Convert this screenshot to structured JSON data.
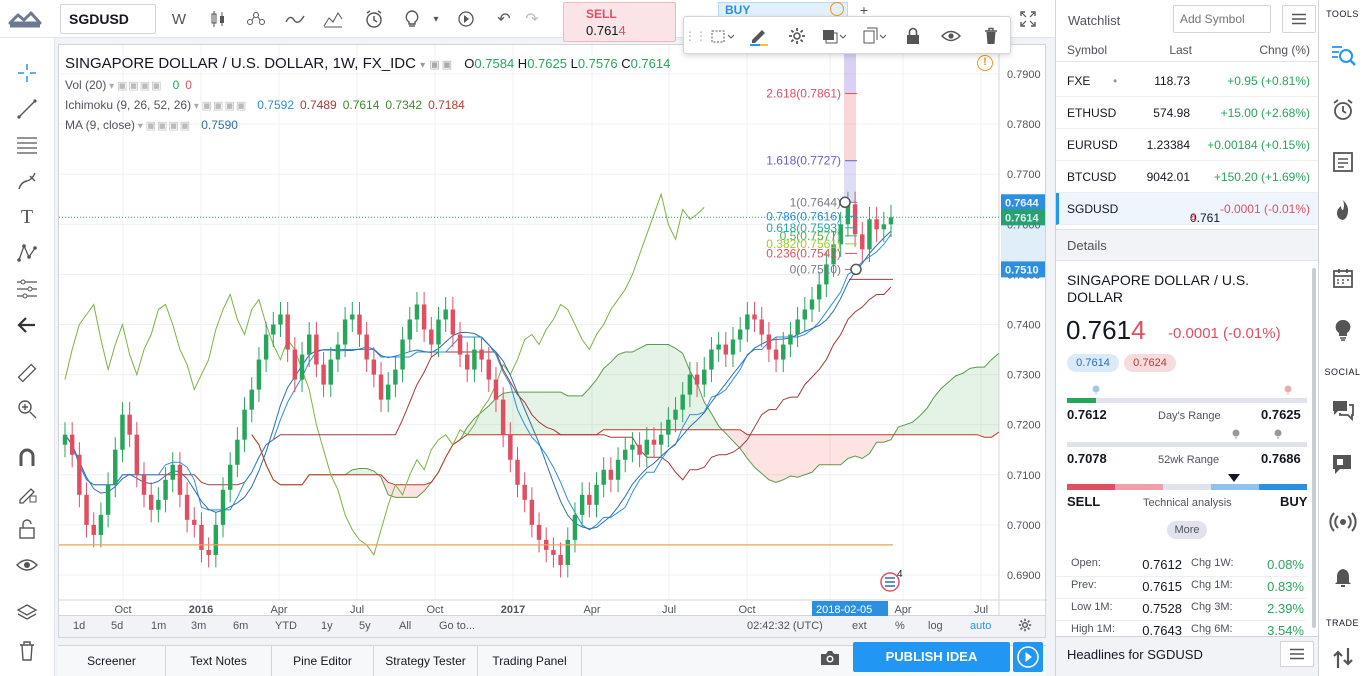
{
  "toolbar": {
    "symbol": "SGDUSD",
    "interval": "W",
    "sell_label": "SELL",
    "sell_price_main": "0.761",
    "sell_price_last": "4",
    "buy_label": "BUY"
  },
  "chart": {
    "title": "SINGAPORE DOLLAR / U.S. DOLLAR, 1W, FX_IDC",
    "ohlc": {
      "o_label": "O",
      "o": "0.7584",
      "h_label": "H",
      "h": "0.7625",
      "l_label": "L",
      "l": "0.7576",
      "c_label": "C",
      "c": "0.7614"
    },
    "indicators": [
      {
        "name": "Vol (20)",
        "values": [
          {
            "v": "0",
            "color": "#26a65b"
          },
          {
            "v": "0",
            "color": "#e04e62"
          }
        ]
      },
      {
        "name": "Ichimoku (9, 26, 52, 26)",
        "values": [
          {
            "v": "0.7592",
            "color": "#2d8fe0"
          },
          {
            "v": "0.7489",
            "color": "#a33a3a"
          },
          {
            "v": "0.7614",
            "color": "#3b8a2c"
          },
          {
            "v": "0.7342",
            "color": "#3b8a2c"
          },
          {
            "v": "0.7184",
            "color": "#c0392b"
          }
        ]
      },
      {
        "name": "MA (9, close)",
        "values": [
          {
            "v": "0.7590",
            "color": "#2d6fb0"
          }
        ]
      }
    ],
    "fib_levels": [
      {
        "label": "2.618(0.7861)",
        "color": "#e04e62"
      },
      {
        "label": "1.618(0.7727)",
        "color": "#6a5bd6"
      },
      {
        "label": "1(0.7644)",
        "color": "#787b86"
      },
      {
        "label": "0.786(0.7616)",
        "color": "#2d8fe0"
      },
      {
        "label": "0.618(0.7593)",
        "color": "#26a69a"
      },
      {
        "label": "0.5(0.7577)",
        "color": "#4caf50"
      },
      {
        "label": "0.382(0.7561)",
        "color": "#9acd32"
      },
      {
        "label": "0.236(0.7542)",
        "color": "#e04e62"
      },
      {
        "label": "0(0.7510)",
        "color": "#787b86"
      }
    ],
    "price_ticks": [
      "0.7900",
      "0.7800",
      "0.7700",
      "0.7600",
      "0.7500",
      "0.7400",
      "0.7300",
      "0.7200",
      "0.7100",
      "0.7000",
      "0.6900"
    ],
    "price_tags": [
      {
        "v": "0.7644",
        "bg": "#2d8fe0"
      },
      {
        "v": "0.7614",
        "bg": "#26a65b"
      },
      {
        "v": "0.7510",
        "bg": "#2d8fe0"
      }
    ],
    "time_ticks": [
      "Oct",
      "2016",
      "Apr",
      "Jul",
      "Oct",
      "2017",
      "Apr",
      "Jul",
      "Oct",
      "2018-02-05",
      "Apr",
      "Jul"
    ],
    "event_badge": "4"
  },
  "chart_data": {
    "type": "candlestick",
    "title": "SINGAPORE DOLLAR / U.S. DOLLAR, 1W, FX_IDC",
    "x_start": "2015-07",
    "x_end": "2018-07",
    "ylim": [
      0.685,
      0.795
    ],
    "close": [
      0.718,
      0.714,
      0.706,
      0.7,
      0.698,
      0.702,
      0.708,
      0.715,
      0.722,
      0.718,
      0.71,
      0.706,
      0.703,
      0.705,
      0.709,
      0.712,
      0.706,
      0.701,
      0.7,
      0.695,
      0.694,
      0.7,
      0.707,
      0.712,
      0.717,
      0.723,
      0.727,
      0.733,
      0.738,
      0.74,
      0.742,
      0.735,
      0.729,
      0.734,
      0.738,
      0.732,
      0.728,
      0.733,
      0.736,
      0.741,
      0.742,
      0.738,
      0.733,
      0.73,
      0.725,
      0.728,
      0.731,
      0.737,
      0.741,
      0.744,
      0.739,
      0.736,
      0.741,
      0.743,
      0.738,
      0.734,
      0.731,
      0.735,
      0.733,
      0.729,
      0.725,
      0.718,
      0.713,
      0.708,
      0.705,
      0.7,
      0.697,
      0.695,
      0.694,
      0.692,
      0.697,
      0.702,
      0.706,
      0.704,
      0.708,
      0.711,
      0.709,
      0.713,
      0.715,
      0.716,
      0.714,
      0.717,
      0.716,
      0.718,
      0.721,
      0.723,
      0.726,
      0.73,
      0.728,
      0.731,
      0.735,
      0.736,
      0.734,
      0.737,
      0.739,
      0.742,
      0.741,
      0.738,
      0.735,
      0.733,
      0.736,
      0.738,
      0.741,
      0.743,
      0.745,
      0.748,
      0.752,
      0.756,
      0.76,
      0.764,
      0.758,
      0.755,
      0.761,
      0.759,
      0.76,
      0.7614
    ],
    "series": [
      {
        "name": "MA (9, close)",
        "color": "#2d6fb0"
      },
      {
        "name": "Ichimoku (9, 26, 52, 26)",
        "color": "#2d8fe0"
      }
    ]
  },
  "range_bar": {
    "ranges": [
      "1d",
      "5d",
      "1m",
      "3m",
      "6m",
      "YTD",
      "1y",
      "5y",
      "All"
    ],
    "goto": "Go to...",
    "clock": "02:42:32 (UTC)",
    "ext": "ext",
    "pct": "%",
    "log": "log",
    "auto": "auto"
  },
  "bottom_tabs": [
    "Screener",
    "Text Notes",
    "Pine Editor",
    "Strategy Tester",
    "Trading Panel"
  ],
  "publish_label": "PUBLISH IDEA",
  "watchlist": {
    "title": "Watchlist",
    "add_placeholder": "Add Symbol",
    "col_symbol": "Symbol",
    "col_last": "Last",
    "col_chng": "Chng (%)",
    "rows": [
      {
        "symbol": "FXE",
        "dot": "•",
        "last": "118.73",
        "chng": "+0.95 (+0.81%)",
        "dir": "pos"
      },
      {
        "symbol": "ETHUSD",
        "dot": "",
        "last": "574.98",
        "chng": "+15.00 (+2.68%)",
        "dir": "pos"
      },
      {
        "symbol": "EURUSD",
        "dot": "",
        "last": "1.23384",
        "chng": "+0.00184 (+0.15%)",
        "dir": "pos"
      },
      {
        "symbol": "BTCUSD",
        "dot": "",
        "last": "9042.01",
        "chng": "+150.20 (+1.69%)",
        "dir": "pos"
      },
      {
        "symbol": "SGDUSD",
        "dot": "",
        "last_main": "0.761",
        "last_tail": "4",
        "chng": "-0.0001 (-0.01%)",
        "dir": "neg"
      }
    ]
  },
  "details": {
    "title": "Details",
    "name": "SINGAPORE DOLLAR / U.S. DOLLAR",
    "price_main": "0.761",
    "price_tail": "4",
    "change": "-0.0001 (-0.01%)",
    "bid": "0.7614",
    "ask": "0.7624",
    "day_low": "0.7612",
    "day_high": "0.7625",
    "day_label": "Day's Range",
    "day_pos": 0.12,
    "wk52_low": "0.7078",
    "wk52_high": "0.7686",
    "wk52_label": "52wk Range",
    "wk52_pos": 0.88,
    "ta_sell": "SELL",
    "ta_label": "Technical analysis",
    "ta_buy": "BUY",
    "more": "More",
    "stats": [
      {
        "k": "Open:",
        "v": "0.7612",
        "ck": "Chg 1W:",
        "cv": "0.08%"
      },
      {
        "k": "Prev:",
        "v": "0.7615",
        "ck": "Chg 1M:",
        "cv": "0.83%"
      },
      {
        "k": "Low 1M:",
        "v": "0.7528",
        "ck": "Chg 3M:",
        "cv": "2.39%"
      },
      {
        "k": "High 1M:",
        "v": "0.7643",
        "ck": "Chg 6M:",
        "cv": "3.54%"
      }
    ],
    "headlines": "Headlines for SGDUSD"
  },
  "right_toolbar": {
    "tools_label": "TOOLS",
    "social_label": "SOCIAL",
    "trade_label": "TRADE"
  }
}
